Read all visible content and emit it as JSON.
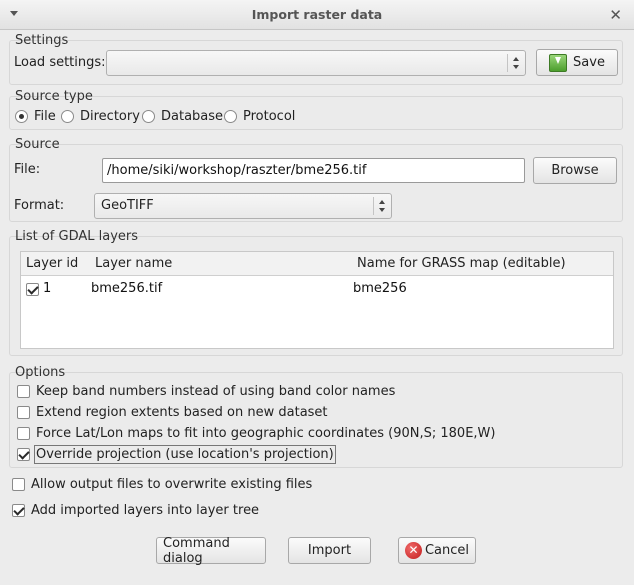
{
  "window": {
    "title": "Import raster data"
  },
  "settings": {
    "group_title": "Settings",
    "load_label": "Load settings:",
    "load_value": "",
    "save_label": "Save"
  },
  "source_type": {
    "group_title": "Source type",
    "options": [
      "File",
      "Directory",
      "Database",
      "Protocol"
    ],
    "selected": "File"
  },
  "source": {
    "group_title": "Source",
    "file_label": "File:",
    "file_value": "/home/siki/workshop/raszter/bme256.tif",
    "browse_label": "Browse",
    "format_label": "Format:",
    "format_value": "GeoTIFF"
  },
  "layers": {
    "group_title": "List of GDAL layers",
    "columns": [
      "Layer id",
      "Layer name",
      "Name for GRASS map (editable)"
    ],
    "rows": [
      {
        "checked": true,
        "id": "1",
        "name": "bme256.tif",
        "grass_name": "bme256"
      }
    ]
  },
  "options": {
    "group_title": "Options",
    "items": [
      {
        "label": "Keep band numbers instead of using band color names",
        "checked": false
      },
      {
        "label": "Extend region extents based on new dataset",
        "checked": false
      },
      {
        "label": "Force Lat/Lon maps to fit into geographic coordinates (90N,S; 180E,W)",
        "checked": false
      },
      {
        "label": "Override projection (use location's projection)",
        "checked": true
      }
    ]
  },
  "extra": {
    "overwrite_label": "Allow output files to overwrite existing files",
    "overwrite_checked": false,
    "add_layers_label": "Add imported layers into layer tree",
    "add_layers_checked": true
  },
  "buttons": {
    "command_dialog": "Command dialog",
    "import": "Import",
    "cancel": "Cancel"
  }
}
